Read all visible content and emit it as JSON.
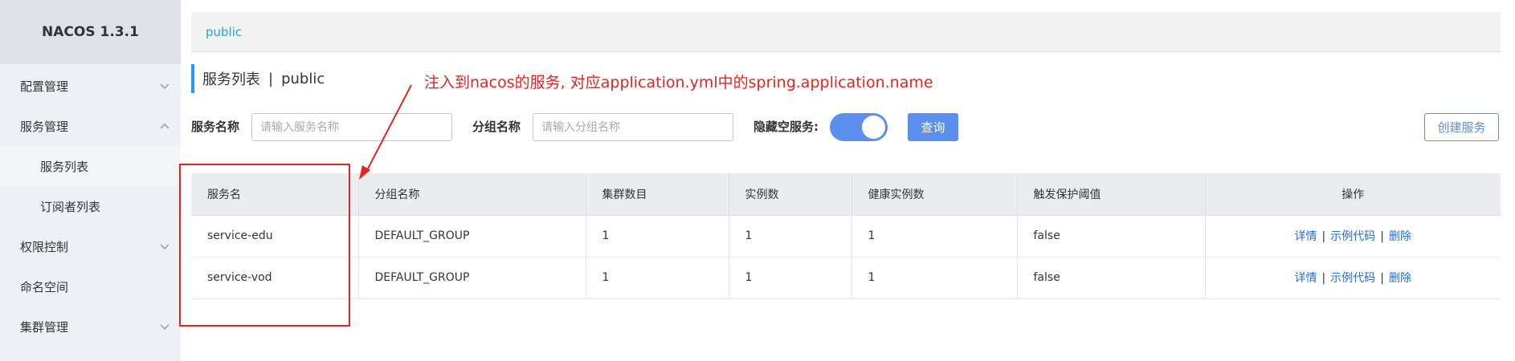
{
  "app": {
    "brand": "NACOS 1.3.1"
  },
  "sidebar": {
    "items": [
      {
        "label": "配置管理",
        "chevron": "down"
      },
      {
        "label": "服务管理",
        "chevron": "up"
      },
      {
        "label": "服务列表",
        "chevron": ""
      },
      {
        "label": "订阅者列表",
        "chevron": ""
      },
      {
        "label": "权限控制",
        "chevron": "down"
      },
      {
        "label": "命名空间",
        "chevron": ""
      },
      {
        "label": "集群管理",
        "chevron": "down"
      }
    ]
  },
  "breadcrumb": {
    "namespace": "public"
  },
  "page": {
    "title": "服务列表",
    "separator": "|",
    "namespace": "public"
  },
  "annotation": {
    "text": "注入到nacos的服务, 对应application.yml中的spring.application.name",
    "color": "#e8221e"
  },
  "filters": {
    "service_name_label": "服务名称",
    "service_name_placeholder": "请输入服务名称",
    "group_name_label": "分组名称",
    "group_name_placeholder": "请输入分组名称",
    "hide_empty_label": "隐藏空服务:",
    "hide_empty_on": true,
    "query_label": "查询",
    "create_label": "创建服务"
  },
  "table": {
    "headers": [
      "服务名",
      "分组名称",
      "集群数目",
      "实例数",
      "健康实例数",
      "触发保护阈值",
      "操作"
    ],
    "rows": [
      {
        "name": "service-edu",
        "group": "DEFAULT_GROUP",
        "clusters": "1",
        "instances": "1",
        "healthy": "1",
        "threshold": "false"
      },
      {
        "name": "service-vod",
        "group": "DEFAULT_GROUP",
        "clusters": "1",
        "instances": "1",
        "healthy": "1",
        "threshold": "false"
      }
    ],
    "ops": {
      "detail": "详情",
      "sample": "示例代码",
      "delete": "删除",
      "sep": "|"
    }
  },
  "colors": {
    "accent": "#5a8fee",
    "link": "#1f6fd8",
    "breadcrumb": "#1ea7d8",
    "sidebar_bg": "#eef0f5"
  }
}
